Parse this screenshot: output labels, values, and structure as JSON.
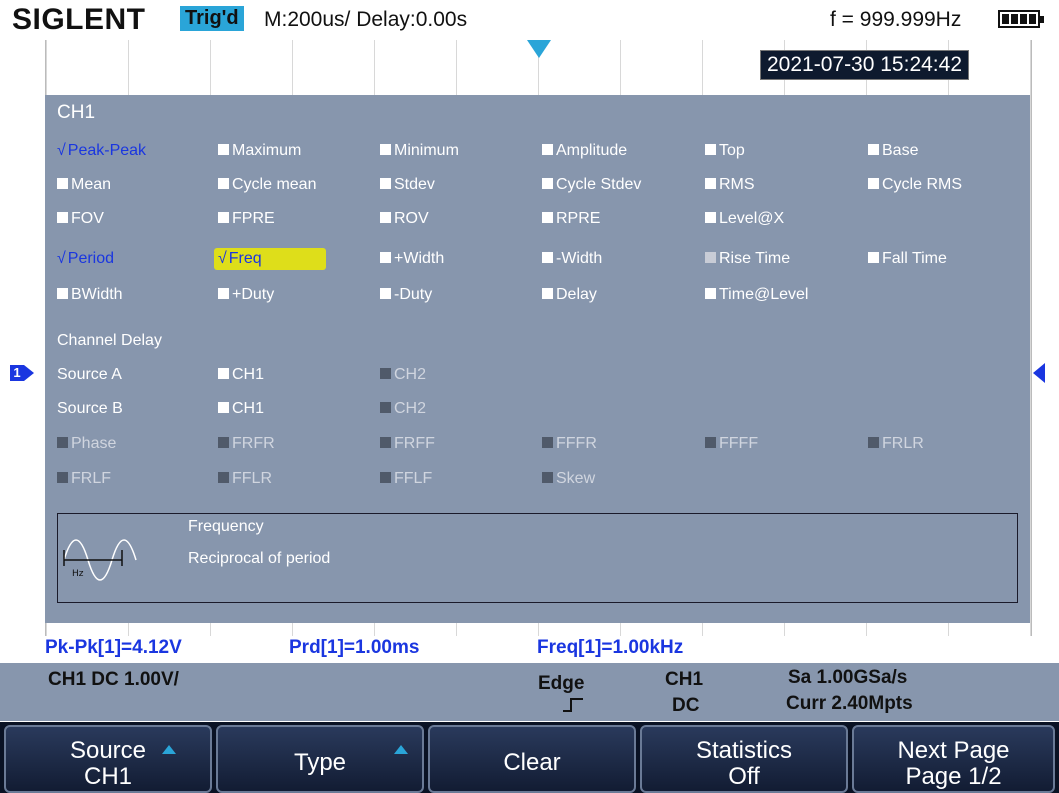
{
  "header": {
    "brand": "SIGLENT",
    "trigger_status": "Trig'd",
    "timebase": "M:200us/ Delay:0.00s",
    "frequency": "f = 999.999Hz",
    "datetime": "2021-07-30 15:24:42"
  },
  "panel": {
    "channel": "CH1",
    "rows": [
      [
        {
          "label": "Peak-Peak",
          "state": "checked"
        },
        {
          "label": "Maximum",
          "state": "unchecked"
        },
        {
          "label": "Minimum",
          "state": "unchecked"
        },
        {
          "label": "Amplitude",
          "state": "unchecked"
        },
        {
          "label": "Top",
          "state": "unchecked"
        },
        {
          "label": "Base",
          "state": "unchecked"
        }
      ],
      [
        {
          "label": "Mean",
          "state": "unchecked"
        },
        {
          "label": "Cycle mean",
          "state": "unchecked"
        },
        {
          "label": "Stdev",
          "state": "unchecked"
        },
        {
          "label": "Cycle Stdev",
          "state": "unchecked"
        },
        {
          "label": "RMS",
          "state": "unchecked"
        },
        {
          "label": "Cycle RMS",
          "state": "unchecked"
        }
      ],
      [
        {
          "label": "FOV",
          "state": "unchecked"
        },
        {
          "label": "FPRE",
          "state": "unchecked"
        },
        {
          "label": "ROV",
          "state": "unchecked"
        },
        {
          "label": "RPRE",
          "state": "unchecked"
        },
        {
          "label": "Level@X",
          "state": "unchecked"
        }
      ],
      [
        {
          "label": "Period",
          "state": "checked"
        },
        {
          "label": "Freq",
          "state": "checked-selected"
        },
        {
          "label": "+Width",
          "state": "unchecked"
        },
        {
          "label": "-Width",
          "state": "unchecked"
        },
        {
          "label": "Rise Time",
          "state": "half"
        },
        {
          "label": "Fall Time",
          "state": "unchecked"
        }
      ],
      [
        {
          "label": "BWidth",
          "state": "unchecked"
        },
        {
          "label": "+Duty",
          "state": "unchecked"
        },
        {
          "label": "-Duty",
          "state": "unchecked"
        },
        {
          "label": "Delay",
          "state": "unchecked"
        },
        {
          "label": "Time@Level",
          "state": "unchecked"
        }
      ]
    ],
    "channel_delay_title": "Channel Delay",
    "source_a": {
      "label": "Source A",
      "ch1": "CH1",
      "ch2": "CH2"
    },
    "source_b": {
      "label": "Source B",
      "ch1": "CH1",
      "ch2": "CH2"
    },
    "delay_rows": [
      [
        "Phase",
        "FRFR",
        "FRFF",
        "FFFR",
        "FFFF",
        "FRLR"
      ],
      [
        "FRLF",
        "FFLR",
        "FFLF",
        "Skew"
      ]
    ],
    "help": {
      "title": "Frequency",
      "text": "Reciprocal of period",
      "icon_label": "Hz"
    }
  },
  "results": {
    "pkpk": "Pk-Pk[1]=4.12V",
    "prd": "Prd[1]=1.00ms",
    "freq": "Freq[1]=1.00kHz"
  },
  "status": {
    "channel": "CH1 DC 1.00V/",
    "trigger_type": "Edge",
    "trigger_source": "CH1",
    "trigger_coupling": "DC",
    "sample_rate": "Sa 1.00GSa/s",
    "memory": "Curr 2.40Mpts"
  },
  "softkeys": [
    {
      "line1": "Source",
      "line2": "CH1",
      "arrow": true
    },
    {
      "line1": "Type",
      "line2": "",
      "arrow": true
    },
    {
      "line1": "Clear",
      "line2": "",
      "arrow": false
    },
    {
      "line1": "Statistics",
      "line2": "Off",
      "arrow": false
    },
    {
      "line1": "Next Page",
      "line2": "Page 1/2",
      "arrow": false
    }
  ],
  "colors": {
    "panel": "#8796ad",
    "selected": "#dede1a",
    "active_text": "#1a36e0",
    "trigger_badge": "#2aa5d8"
  }
}
